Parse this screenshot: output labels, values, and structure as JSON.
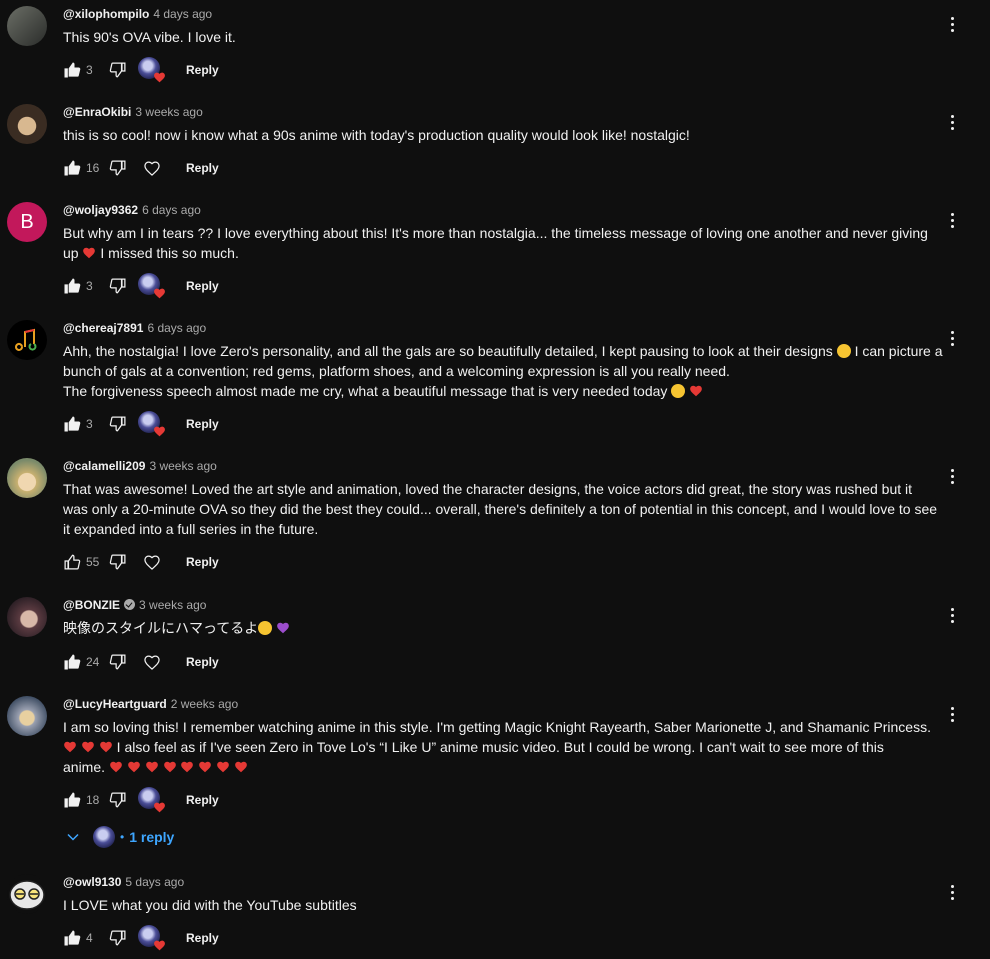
{
  "comments": [
    {
      "author": "@xilophompilo",
      "time": "4 days ago",
      "text": "This 90's OVA vibe. I love it.",
      "likes": "3",
      "liked": true,
      "hearted": true,
      "reply": "Reply",
      "avatar_colors": [
        "#6b6e66",
        "#2a2c2a"
      ]
    },
    {
      "author": "@EnraOkibi",
      "time": "3 weeks ago",
      "text": "this is so cool! now i know what a 90s anime with today's production quality would look like! nostalgic!",
      "likes": "16",
      "liked": true,
      "hearted": false,
      "reply": "Reply",
      "avatar_colors": [
        "#b4966d",
        "#3a2c22"
      ]
    },
    {
      "author": "@woljay9362",
      "time": "6 days ago",
      "text": "But why am I in tears ?? I love everything about this! It's more than nostalgia... the timeless message of loving one another and never giving up",
      "text2": "I missed this so much.",
      "likes": "3",
      "liked": true,
      "hearted": true,
      "reply": "Reply",
      "avatar_letter": "B",
      "avatar_colors": [
        "#c2185b",
        "#c2185b"
      ]
    },
    {
      "author": "@chereaj7891",
      "time": "6 days ago",
      "text_lines": [
        "Ahh, the nostalgia! I love Zero's personality, and all the gals are so beautifully detailed, I kept pausing to look at their designs",
        "I can picture a bunch of gals at a convention; red gems, platform shoes, and a welcoming expression is all you really need.",
        "The forgiveness speech almost made me cry, what a beautiful message that is very needed today"
      ],
      "likes": "3",
      "liked": true,
      "hearted": true,
      "reply": "Reply",
      "avatar_colors": [
        "#1a1a1a",
        "#000000"
      ]
    },
    {
      "author": "@calamelli209",
      "time": "3 weeks ago",
      "text": "That was awesome! Loved the art style and animation, loved the character designs, the voice actors did great, the story was rushed but it was only a 20-minute OVA so they did the best they could... overall, there's definitely a ton of potential in this concept, and I would love to see it expanded into a full series in the future.",
      "likes": "55",
      "liked": false,
      "hearted": false,
      "reply": "Reply",
      "avatar_colors": [
        "#d9c9a0",
        "#7a8a6a"
      ]
    },
    {
      "author": "@BONZIE",
      "time": "3 weeks ago",
      "verified": true,
      "text": "映像のスタイルにハマってるよ",
      "likes": "24",
      "liked": true,
      "hearted": false,
      "reply": "Reply",
      "avatar_colors": [
        "#8a6a70",
        "#2a1e24"
      ]
    },
    {
      "author": "@LucyHeartguard",
      "time": "2 weeks ago",
      "text_a": "I am so loving this! I remember watching anime in this style. I'm getting Magic Knight Rayearth, Saber Marionette J, and Shamanic Princess.",
      "text_b": "I also feel as if I've seen  Zero in Tove Lo's “I Like U” anime music video. But I could be wrong. I can't wait to see more of this",
      "text_c": "anime.",
      "likes": "18",
      "liked": true,
      "hearted": true,
      "reply": "Reply",
      "replies": "1 reply",
      "avatar_colors": [
        "#9aa0b0",
        "#3b4a60"
      ]
    },
    {
      "author": "@owl9130",
      "time": "5 days ago",
      "text": "I LOVE what you did with the YouTube subtitles",
      "likes": "4",
      "liked": true,
      "hearted": true,
      "reply": "Reply",
      "avatar_colors": [
        "#f0f0f0",
        "#c8c8c8"
      ]
    }
  ],
  "colors": {
    "background": "#0f0f0f",
    "text": "#f1f1f1",
    "secondary": "#aaaaaa",
    "link": "#3ea6ff",
    "heart": "#e53935",
    "verified": "#aaaaaa"
  }
}
